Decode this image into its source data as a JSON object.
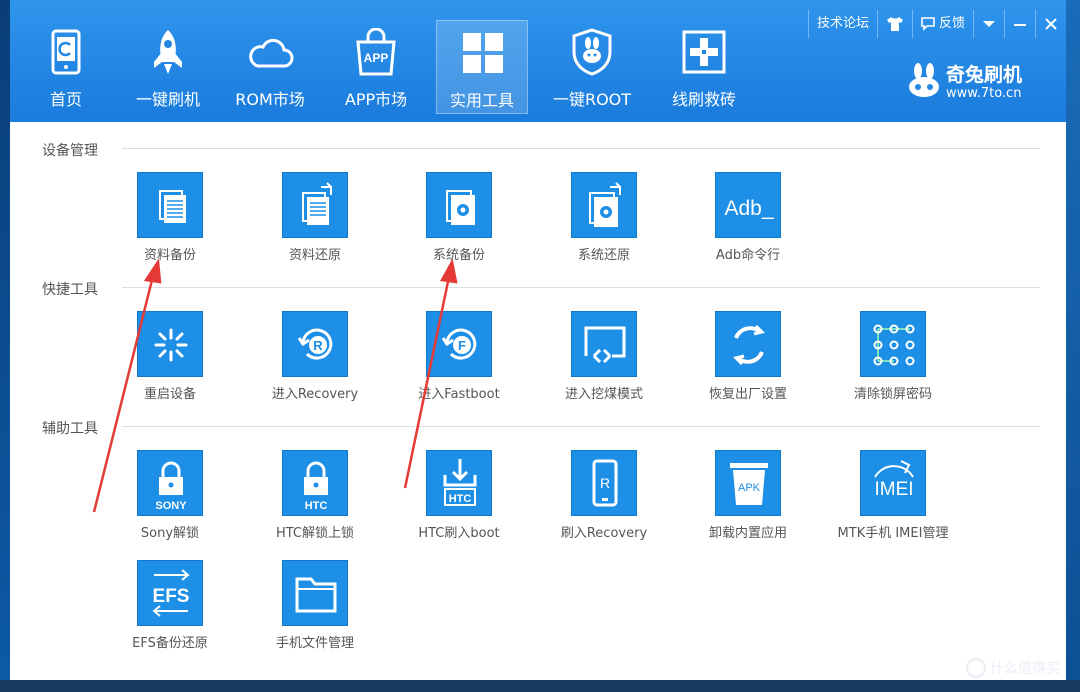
{
  "nav": [
    {
      "label": "首页",
      "icon": "phone-icon"
    },
    {
      "label": "一键刷机",
      "icon": "rocket-icon"
    },
    {
      "label": "ROM市场",
      "icon": "cloud-icon"
    },
    {
      "label": "APP市场",
      "icon": "shopping-bag-icon",
      "icon_text": "APP"
    },
    {
      "label": "实用工具",
      "icon": "grid-icon",
      "active": true
    },
    {
      "label": "一键ROOT",
      "icon": "shield-rabbit-icon"
    },
    {
      "label": "线刷救砖",
      "icon": "first-aid-icon"
    }
  ],
  "topbar": {
    "forum": "技术论坛",
    "feedback": "反馈",
    "shirt_icon": "tshirt-icon",
    "menu_icon": "chevron-down-icon",
    "minimize_icon": "minimize-icon",
    "close_icon": "close-icon"
  },
  "brand": {
    "name": "奇兔刷机",
    "url": "www.7to.cn"
  },
  "sections": [
    {
      "title": "设备管理",
      "tools": [
        {
          "label": "资料备份",
          "icon": "document-stack-icon"
        },
        {
          "label": "资料还原",
          "icon": "document-restore-icon"
        },
        {
          "label": "系统备份",
          "icon": "gear-document-icon"
        },
        {
          "label": "系统还原",
          "icon": "gear-restore-icon"
        },
        {
          "label": "Adb命令行",
          "icon": "adb-icon",
          "icon_text": "Adb_"
        }
      ]
    },
    {
      "title": "快捷工具",
      "tools": [
        {
          "label": "重启设备",
          "icon": "loading-spinner-icon"
        },
        {
          "label": "进入Recovery",
          "icon": "recovery-r-icon",
          "icon_text": "R"
        },
        {
          "label": "进入Fastboot",
          "icon": "fastboot-f-icon",
          "icon_text": "F"
        },
        {
          "label": "进入挖煤模式",
          "icon": "screen-cast-icon"
        },
        {
          "label": "恢复出厂设置",
          "icon": "refresh-icon"
        },
        {
          "label": "清除锁屏密码",
          "icon": "pattern-lock-icon"
        }
      ]
    },
    {
      "title": "辅助工具",
      "tools": [
        {
          "label": "Sony解锁",
          "icon": "lock-sony-icon",
          "icon_text": "SONY"
        },
        {
          "label": "HTC解锁上锁",
          "icon": "lock-htc-icon",
          "icon_text": "HTC"
        },
        {
          "label": "HTC刷入boot",
          "icon": "download-htc-icon",
          "icon_text": "HTC"
        },
        {
          "label": "刷入Recovery",
          "icon": "phone-r-icon",
          "icon_text": "R"
        },
        {
          "label": "卸载内置应用",
          "icon": "apk-trash-icon",
          "icon_text": "APK"
        },
        {
          "label": "MTK手机 IMEI管理",
          "icon": "imei-icon",
          "icon_text": "IMEI"
        },
        {
          "label": "EFS备份还原",
          "icon": "efs-icon",
          "icon_text": "EFS"
        },
        {
          "label": "手机文件管理",
          "icon": "folder-icon"
        }
      ]
    }
  ],
  "watermark": "什么值得买",
  "colors": {
    "header": "#2389e4",
    "tile": "#1e8fe6",
    "arrow": "#e53935"
  }
}
